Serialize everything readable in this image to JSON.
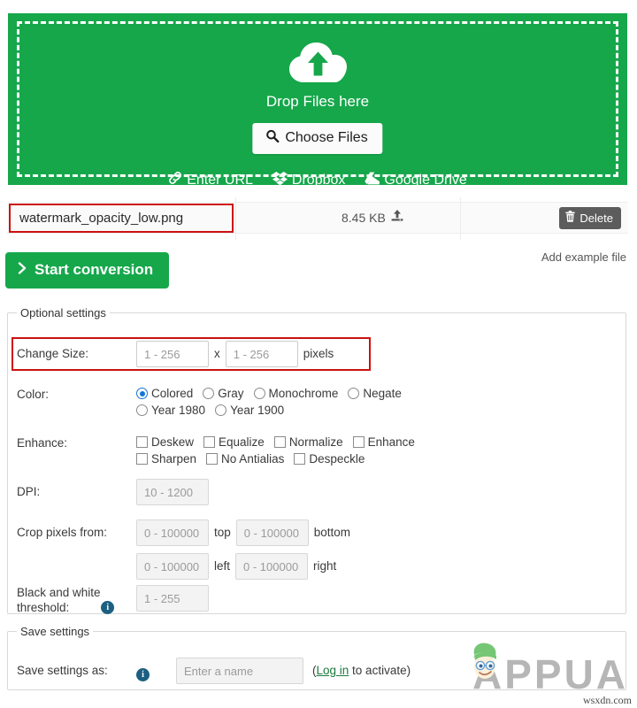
{
  "dropzone": {
    "icon": "cloud-upload-icon",
    "title": "Drop Files here",
    "choose_files_label": "Choose Files",
    "choose_files_icon": "search-icon",
    "services": [
      {
        "label": "Enter URL",
        "icon": "link-icon"
      },
      {
        "label": "Dropbox",
        "icon": "dropbox-icon"
      },
      {
        "label": "Google Drive",
        "icon": "google-drive-icon"
      }
    ]
  },
  "file_row": {
    "name": "watermark_opacity_low.png",
    "size": "8.45 KB",
    "upload_icon": "upload-icon",
    "delete_label": "Delete",
    "delete_icon": "trash-icon"
  },
  "actions": {
    "start_label": "Start conversion",
    "start_icon": "chevron-right-icon",
    "add_example_label": "Add example file"
  },
  "optional_settings": {
    "legend": "Optional settings",
    "change_size": {
      "label": "Change Size:",
      "width_placeholder": "1 - 256",
      "separator": "x",
      "height_placeholder": "1 - 256",
      "unit": "pixels"
    },
    "color": {
      "label": "Color:",
      "options": [
        {
          "label": "Colored",
          "checked": true
        },
        {
          "label": "Gray",
          "checked": false
        },
        {
          "label": "Monochrome",
          "checked": false
        },
        {
          "label": "Negate",
          "checked": false
        },
        {
          "label": "Year 1980",
          "checked": false
        },
        {
          "label": "Year 1900",
          "checked": false
        }
      ]
    },
    "enhance": {
      "label": "Enhance:",
      "options": [
        {
          "label": "Deskew",
          "checked": false
        },
        {
          "label": "Equalize",
          "checked": false
        },
        {
          "label": "Normalize",
          "checked": false
        },
        {
          "label": "Enhance",
          "checked": false
        },
        {
          "label": "Sharpen",
          "checked": false
        },
        {
          "label": "No Antialias",
          "checked": false
        },
        {
          "label": "Despeckle",
          "checked": false
        }
      ]
    },
    "dpi": {
      "label": "DPI:",
      "placeholder": "10 - 1200"
    },
    "crop": {
      "label": "Crop pixels from:",
      "top": {
        "placeholder": "0 - 100000",
        "unit": "top"
      },
      "bottom": {
        "placeholder": "0 - 100000",
        "unit": "bottom"
      },
      "left": {
        "placeholder": "0 - 100000",
        "unit": "left"
      },
      "right": {
        "placeholder": "0 - 100000",
        "unit": "right"
      }
    },
    "bw_threshold": {
      "label_line1": "Black and white",
      "label_line2": "threshold:",
      "placeholder": "1 - 255",
      "info_icon": "info-icon"
    }
  },
  "save_settings": {
    "legend": "Save settings",
    "label": "Save settings as:",
    "info_icon": "info-icon",
    "name_placeholder": "Enter a name",
    "note_prefix": "(",
    "login_link": "Log in",
    "note_suffix": " to activate)"
  },
  "watermark": {
    "brand": "APPUALS",
    "source": "wsxdn.com"
  },
  "colors": {
    "brand_green": "#16a74b",
    "highlight_red": "#cc1111",
    "radio_blue": "#1274d6",
    "delete_grey": "#5c5c5c",
    "info_blue": "#1c5f81",
    "link_green": "#1b7a3c"
  }
}
